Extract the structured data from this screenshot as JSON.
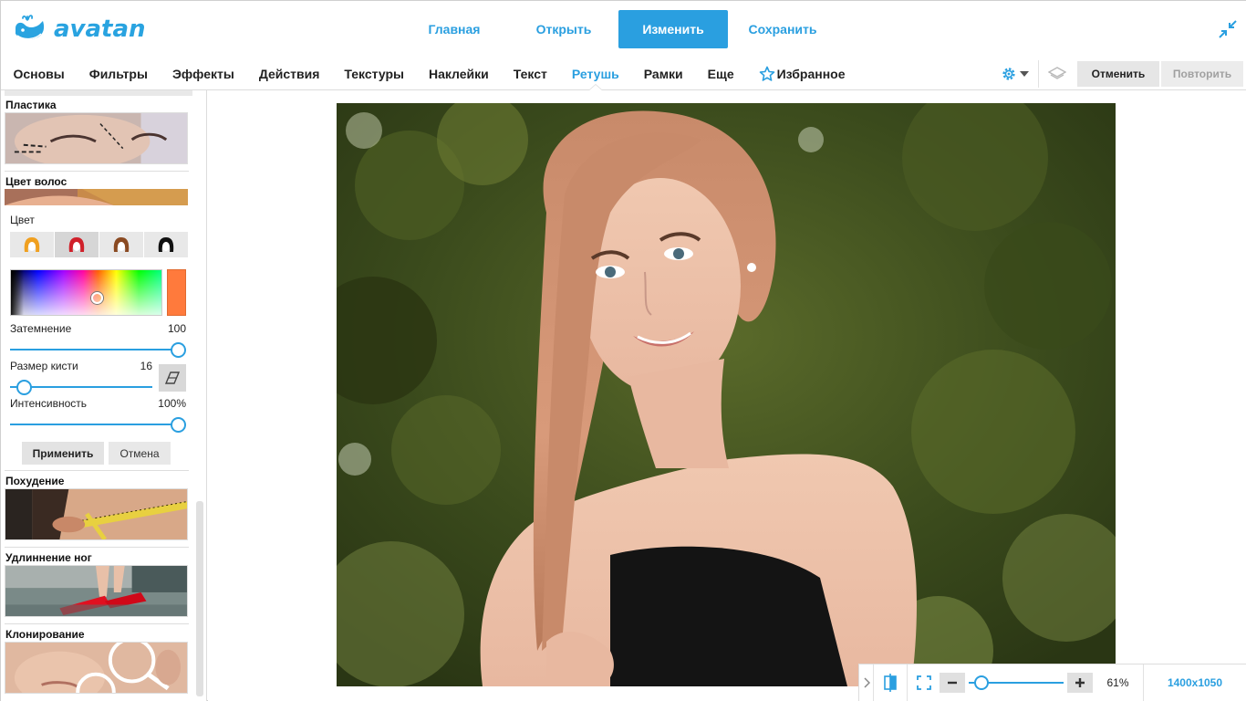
{
  "app": {
    "logo_text": "avatan",
    "main_nav": [
      "Главная",
      "Открыть",
      "Изменить",
      "Сохранить"
    ],
    "active_main": "Изменить"
  },
  "tool_menu": {
    "items": [
      "Основы",
      "Фильтры",
      "Эффекты",
      "Действия",
      "Текстуры",
      "Наклейки",
      "Текст",
      "Ретушь",
      "Рамки",
      "Еще"
    ],
    "favorites": "Избранное",
    "active": "Ретушь",
    "undo_label": "Отменить",
    "redo_label": "Повторить"
  },
  "sidebar": {
    "plastic": "Пластика",
    "hair_color": "Цвет волос",
    "color_label": "Цвет",
    "hair_swatches": [
      "#f0a020",
      "#d0202a",
      "#8a4a22",
      "#111111"
    ],
    "selected_color": "#ff7a3c",
    "sliders": [
      {
        "label": "Затемнение",
        "value": "100",
        "fraction": 1.0
      },
      {
        "label": "Размер кисти",
        "value": "16",
        "fraction": 0.1
      },
      {
        "label": "Интенсивность",
        "value": "100%",
        "fraction": 1.0
      }
    ],
    "apply_label": "Применить",
    "cancel_label": "Отмена",
    "slimming": "Похудение",
    "legs": "Удлиннение ног",
    "clone": "Клонирование"
  },
  "bottom": {
    "zoom": "61%",
    "image_size": "1400x1050"
  },
  "colors": {
    "accent": "#2a9fe0"
  }
}
